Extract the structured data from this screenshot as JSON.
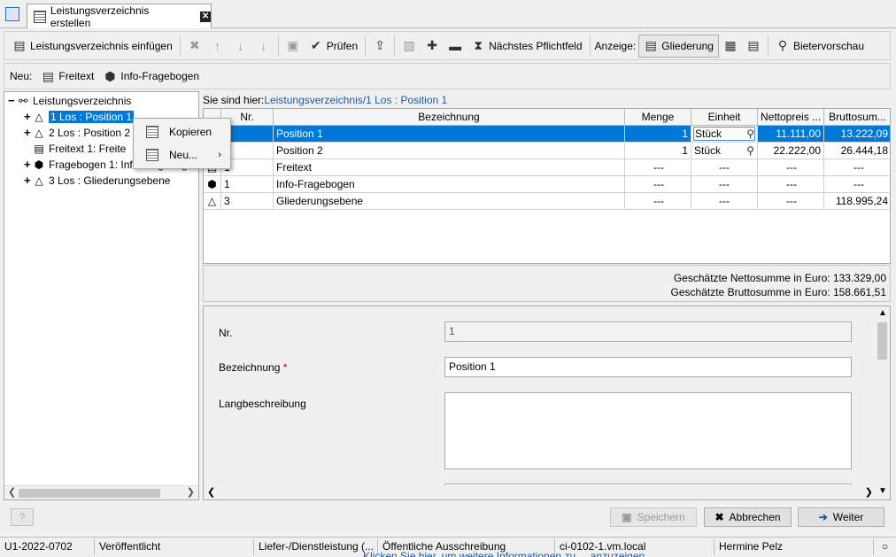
{
  "tab": {
    "title": "Leistungsverzeichnis erstellen"
  },
  "toolbar": {
    "insert_lv": "Leistungsverzeichnis einfügen",
    "check": "Prüfen",
    "next_required": "Nächstes Pflichtfeld",
    "display_label": "Anzeige:",
    "outline": "Gliederung",
    "bidder_preview": "Bietervorschau"
  },
  "newbar": {
    "label": "Neu:",
    "freitext": "Freitext",
    "info": "Info-Fragebogen"
  },
  "tree": {
    "root": "Leistungsverzeichnis",
    "items": [
      {
        "label": "1 Los : Position 1"
      },
      {
        "label": "2 Los : Position 2"
      },
      {
        "label": "Freitext 1:  Freite"
      },
      {
        "label": "Fragebogen 1: Info-Fragebog"
      },
      {
        "label": "3 Los : Gliederungsebene"
      }
    ]
  },
  "context_menu": {
    "copy": "Kopieren",
    "new": "Neu..."
  },
  "breadcrumb": {
    "prefix": "Sie sind hier:",
    "link1": "Leistungsverzeichnis",
    "sep": "/",
    "link2": "1 Los : Position 1"
  },
  "grid": {
    "headers": [
      "",
      "Nr.",
      "Bezeichnung",
      "Menge",
      "Einheit",
      "Nettopreis ...",
      "Bruttosum..."
    ],
    "rows": [
      {
        "nr": "",
        "bez": "Position 1",
        "menge": "1",
        "einheit": "Stück",
        "netto": "11.111,00",
        "brutto": "13.222,09"
      },
      {
        "nr": "",
        "bez": "Position 2",
        "menge": "1",
        "einheit": "Stück",
        "netto": "22.222,00",
        "brutto": "26.444,18"
      },
      {
        "nr": "1",
        "bez": "Freitext",
        "menge": "---",
        "einheit": "---",
        "netto": "---",
        "brutto": "---"
      },
      {
        "nr": "1",
        "bez": "Info-Fragebogen",
        "menge": "---",
        "einheit": "---",
        "netto": "---",
        "brutto": "---"
      },
      {
        "nr": "3",
        "bez": "Gliederungsebene",
        "menge": "---",
        "einheit": "---",
        "netto": "---",
        "brutto": "118.995,24"
      }
    ]
  },
  "sums": {
    "netto": "Geschätzte Nettosumme in Euro: 133.329,00",
    "brutto": "Geschätzte Bruttosumme in Euro: 158.661,51"
  },
  "form": {
    "nr_label": "Nr.",
    "nr_value": "1",
    "bez_label": "Bezeichnung",
    "bez_req": "*",
    "bez_value": "Position 1",
    "lang_label": "Langbeschreibung",
    "lang_value": ""
  },
  "buttons": {
    "save": "Speichern",
    "cancel": "Abbrechen",
    "next": "Weiter"
  },
  "status": {
    "id": "U1-2022-0702",
    "state": "Veröffentlicht",
    "type": "Liefer-/Dienstleistung (...",
    "procedure": "Öffentliche Ausschreibung",
    "host": "ci-0102-1.vm.local",
    "user": "Hermine Pelz"
  },
  "underline_text": "Klicken Sie hier, um weitere Informationen zu ... anzuzeigen",
  "colors": {
    "selection": "#0078d7",
    "link": "#1b5aa6",
    "required": "#cc0000"
  }
}
